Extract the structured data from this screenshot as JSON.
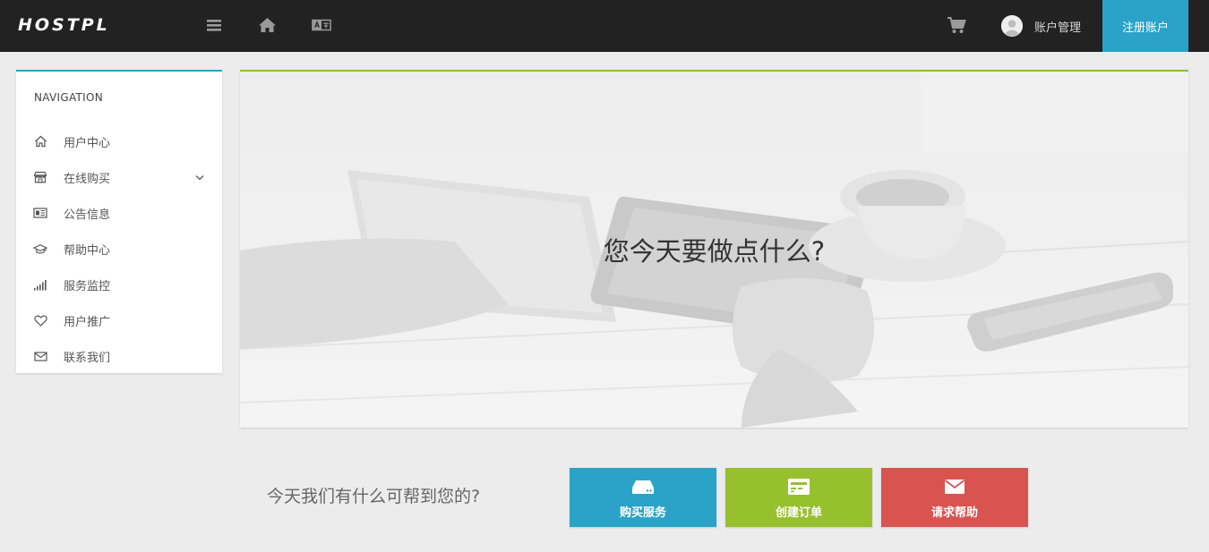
{
  "header": {
    "logo_text": "HOSTPL",
    "icons": [
      "menu-icon",
      "home-icon",
      "language-icon",
      "cart-icon",
      "avatar-icon"
    ],
    "account_label": "账户管理",
    "register_label": "注册账户",
    "colors": {
      "bar": "#222222",
      "register": "#2ba3c8"
    }
  },
  "sidebar": {
    "title": "NAVIGATION",
    "accent": "#2ba3c8",
    "items": [
      {
        "label": "用户中心",
        "icon": "home-icon"
      },
      {
        "label": "在线购买",
        "icon": "store-icon",
        "has_submenu": true
      },
      {
        "label": "公告信息",
        "icon": "newspaper-icon"
      },
      {
        "label": "帮助中心",
        "icon": "graduation-cap-icon"
      },
      {
        "label": "服务监控",
        "icon": "signal-icon"
      },
      {
        "label": "用户推广",
        "icon": "heart-icon"
      },
      {
        "label": "联系我们",
        "icon": "envelope-icon"
      }
    ]
  },
  "hero": {
    "title": "您今天要做点什么?",
    "accent": "#8fbf2f"
  },
  "actions": {
    "prompt": "今天我们有什么可帮到您的?",
    "buttons": [
      {
        "label": "购买服务",
        "icon": "server-icon",
        "color": "#2ba3c8"
      },
      {
        "label": "创建订单",
        "icon": "credit-card-icon",
        "color": "#97c02f"
      },
      {
        "label": "请求帮助",
        "icon": "envelope-icon",
        "color": "#d9534f"
      }
    ]
  }
}
